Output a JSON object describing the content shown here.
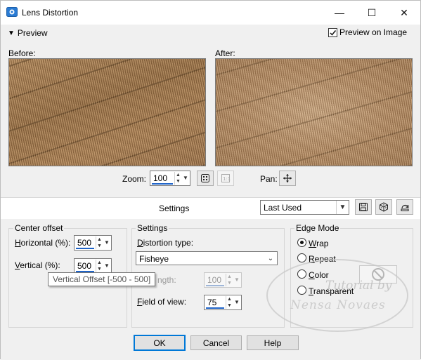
{
  "window": {
    "title": "Lens Distortion",
    "minimize_glyph": "—",
    "maximize_glyph": "☐",
    "close_glyph": "✕"
  },
  "preview_bar": {
    "toggle_label": "Preview",
    "preview_on_image_label": "Preview on Image",
    "preview_on_image_checked": true
  },
  "before": {
    "label": "Before:"
  },
  "after": {
    "label": "After:"
  },
  "zoom": {
    "label": "Zoom:",
    "value": "100"
  },
  "pan": {
    "label": "Pan:"
  },
  "settings_bar": {
    "label": "Settings",
    "preset_value": "Last Used"
  },
  "center_offset": {
    "title": "Center offset",
    "horizontal_label": "Horizontal (%):",
    "horizontal_value": "500",
    "vertical_label": "Vertical (%):",
    "vertical_value": "500",
    "tooltip": "Vertical Offset [-500 - 500]"
  },
  "settings_group": {
    "title": "Settings",
    "distortion_type_label": "Distortion type:",
    "distortion_type_value": "Fisheye",
    "strength_label": "ngth:",
    "strength_value": "100",
    "field_of_view_label": "Field of view:",
    "field_of_view_value": "75"
  },
  "edge_mode": {
    "title": "Edge Mode",
    "options": [
      {
        "label": "Wrap",
        "checked": true
      },
      {
        "label": "Repeat",
        "checked": false
      },
      {
        "label": "Color",
        "checked": false
      },
      {
        "label": "Transparent",
        "checked": false
      }
    ]
  },
  "buttons": {
    "ok": "OK",
    "cancel": "Cancel",
    "help": "Help"
  },
  "watermark": {
    "line1": "Tutorial by",
    "line2": "Nensa Novaes"
  },
  "colors": {
    "accent": "#0078d7",
    "spin_underline": "#1f64c8",
    "panel_bg": "#f0f0f0"
  }
}
